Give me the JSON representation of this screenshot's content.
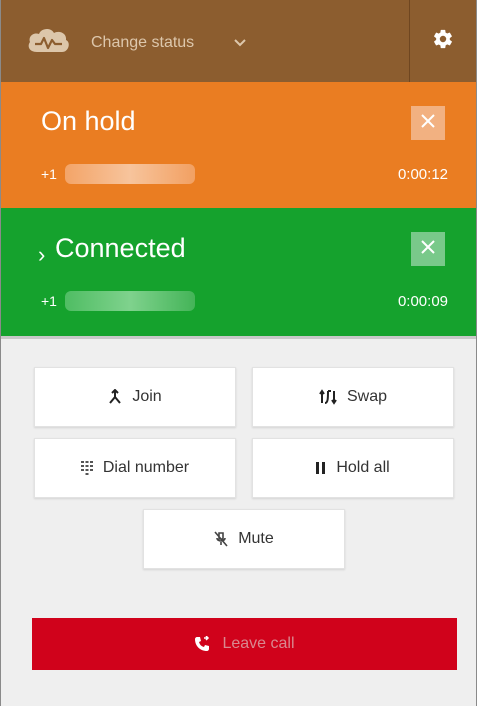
{
  "header": {
    "status_label": "Change status",
    "logo_icon": "cloud-phone-logo-icon",
    "settings_icon": "gear-icon",
    "background": "#8c5d2f"
  },
  "calls": {
    "on_hold": {
      "title": "On hold",
      "phone_prefix": "+1",
      "timer": "0:00:12",
      "color": "#ea7d22"
    },
    "connected": {
      "expander": "›",
      "title": "Connected",
      "phone_prefix": "+1",
      "timer": "0:00:09",
      "color": "#15a22d"
    }
  },
  "actions": {
    "join": "Join",
    "swap": "Swap",
    "dial_number": "Dial number",
    "hold_all": "Hold all",
    "mute": "Mute"
  },
  "leave_call": {
    "label": "Leave call",
    "color": "#d0021b"
  }
}
